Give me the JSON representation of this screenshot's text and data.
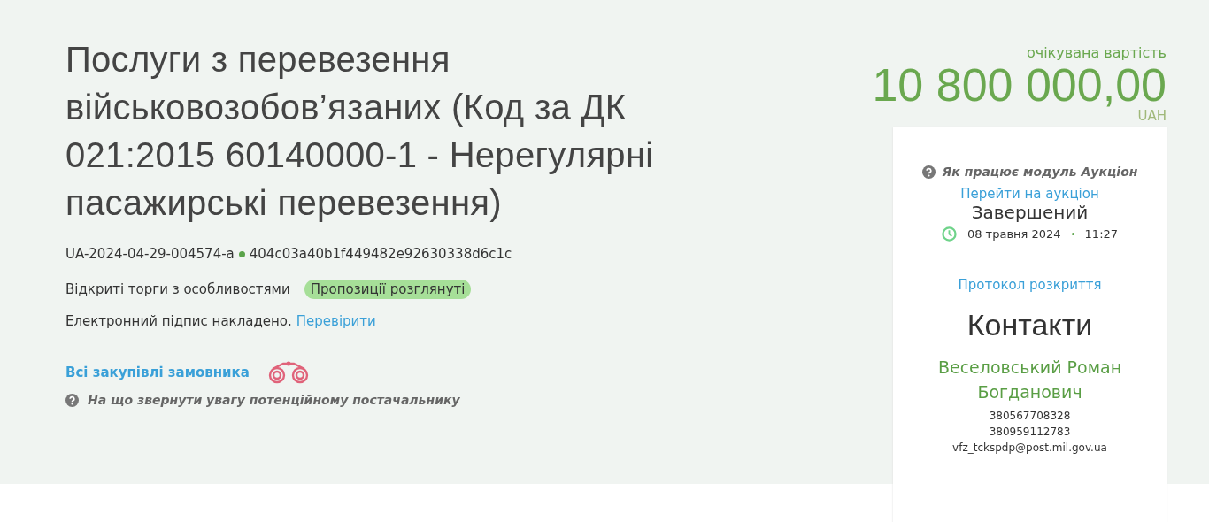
{
  "title": "Послуги з перевезення військовозобов’язаних (Код за ДК 021:2015 60140000-1 - Нерегулярні пасажирські перевезення)",
  "tender_id": "UA-2024-04-29-004574-a",
  "hash": "404c03a40b1f449482e92630338d6c1c",
  "procedure": "Відкриті торги з особливостями",
  "status_badge": "Пропозиції розглянуті",
  "signature": {
    "text": "Електронний підпис накладено.",
    "link": "Перевірити"
  },
  "all_purchases_link": "Всі закупівлі замовника",
  "supplier_hint": "На що звернути увагу потенційному постачальнику",
  "value": {
    "label": "очікувана вартість",
    "amount": "10 800 000,00",
    "currency": "UAH"
  },
  "auction": {
    "help": "Як працює модуль Аукціон",
    "link": "Перейти на аукціон",
    "status": "Завершений",
    "date": "08 травня 2024",
    "time": "11:27"
  },
  "protocol_link": "Протокол розкриття",
  "contacts": {
    "title": "Контакти",
    "name": "Веселовський Роман Богданович",
    "phones": [
      "380567708328",
      "380959112783"
    ],
    "email": "vfz_tckspdp@post.mil.gov.ua"
  }
}
